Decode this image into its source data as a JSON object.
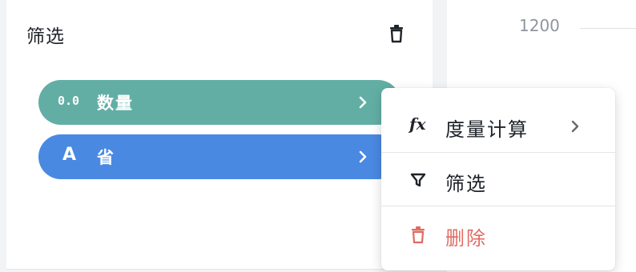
{
  "filter_panel": {
    "title": "筛选",
    "fields": [
      {
        "type_tag": "0.0",
        "label": "数量",
        "kind": "measure",
        "color": "#62aea5"
      },
      {
        "type_tag": "A",
        "label": "省",
        "kind": "dimension",
        "color": "#4a89e2"
      }
    ]
  },
  "chart": {
    "y_tick": "1200"
  },
  "context_menu": {
    "items": [
      {
        "icon": "fx-icon",
        "icon_text": "fx",
        "label": "度量计算",
        "has_submenu": true
      },
      {
        "icon": "funnel-icon",
        "label": "筛选",
        "has_submenu": false
      },
      {
        "icon": "trash-icon",
        "label": "删除",
        "danger": true,
        "color": "#e06b62"
      }
    ]
  }
}
